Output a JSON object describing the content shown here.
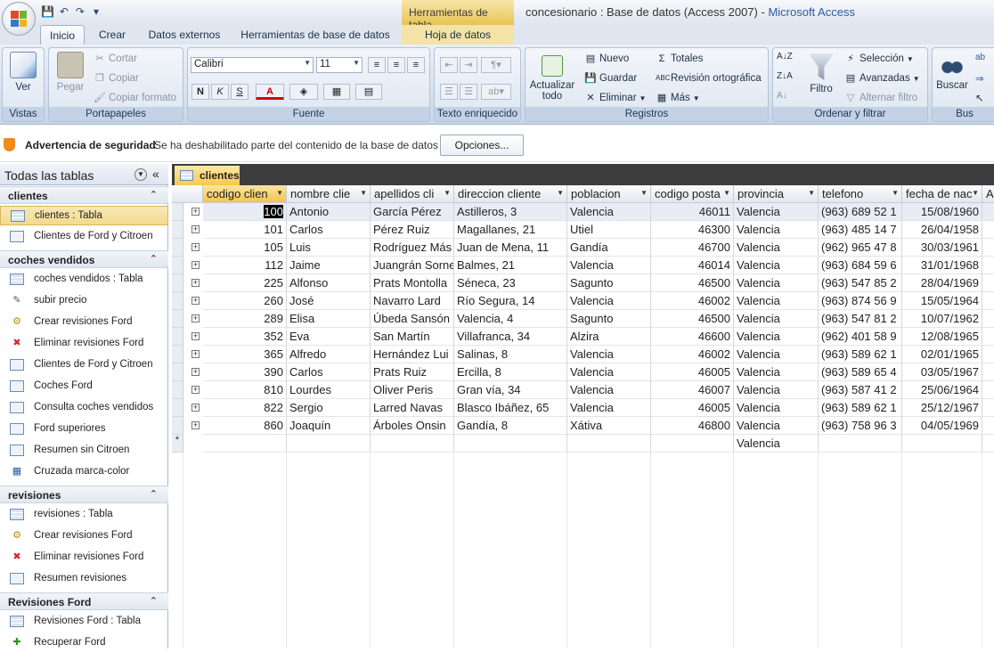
{
  "quick_access": {
    "save": "💾",
    "undo": "↶",
    "redo": "↷",
    "customize": "▾"
  },
  "title": {
    "contextual_tab": "Herramientas de tabla",
    "window_title": "concesionario : Base de datos (Access 2007) -",
    "app_name": "Microsoft Access"
  },
  "tabs": [
    "Inicio",
    "Crear",
    "Datos externos",
    "Herramientas de base de datos",
    "Hoja de datos"
  ],
  "ribbon": {
    "vistas": {
      "label": "Vistas",
      "ver": "Ver"
    },
    "portapapeles": {
      "label": "Portapapeles",
      "pegar": "Pegar",
      "cortar": "Cortar",
      "copiar": "Copiar",
      "copiar_formato": "Copiar formato"
    },
    "fuente": {
      "label": "Fuente",
      "font_name": "Calibri",
      "font_size": "11",
      "bold": "N",
      "italic": "K",
      "underline": "S",
      "color": "A"
    },
    "texto": {
      "label": "Texto enriquecido"
    },
    "registros": {
      "label": "Registros",
      "actualizar": "Actualizar",
      "todo": "todo",
      "nuevo": "Nuevo",
      "guardar": "Guardar",
      "eliminar": "Eliminar",
      "totales": "Totales",
      "revision": "Revisión ortográfica",
      "mas": "Más"
    },
    "ordenar": {
      "label": "Ordenar y filtrar",
      "filtro": "Filtro",
      "seleccion": "Selección",
      "avanzadas": "Avanzadas",
      "alternar": "Alternar filtro"
    },
    "buscar": {
      "label": "Bus",
      "buscar": "Buscar"
    }
  },
  "security": {
    "title": "Advertencia de seguridad",
    "message": "Se ha deshabilitado parte del contenido de la base de datos",
    "options": "Opciones..."
  },
  "nav": {
    "header": "Todas las tablas",
    "groups": [
      {
        "name": "clientes",
        "items": [
          {
            "label": "clientes : Tabla",
            "icon": "table"
          },
          {
            "label": "Clientes de Ford y Citroen",
            "icon": "query"
          }
        ]
      },
      {
        "name": "coches vendidos",
        "items": [
          {
            "label": "coches vendidos : Tabla",
            "icon": "table"
          },
          {
            "label": "subir precio",
            "icon": "update"
          },
          {
            "label": "Crear revisiones Ford",
            "icon": "make-table"
          },
          {
            "label": "Eliminar revisiones Ford",
            "icon": "delete"
          },
          {
            "label": "Clientes de Ford y Citroen",
            "icon": "query"
          },
          {
            "label": "Coches Ford",
            "icon": "query"
          },
          {
            "label": "Consulta coches vendidos",
            "icon": "query"
          },
          {
            "label": "Ford superiores",
            "icon": "query"
          },
          {
            "label": "Resumen sin Citroen",
            "icon": "query"
          },
          {
            "label": "Cruzada marca-color",
            "icon": "crosstab"
          }
        ]
      },
      {
        "name": "revisiones",
        "items": [
          {
            "label": "revisiones : Tabla",
            "icon": "table"
          },
          {
            "label": "Crear revisiones Ford",
            "icon": "make-table"
          },
          {
            "label": "Eliminar revisiones Ford",
            "icon": "delete"
          },
          {
            "label": "Resumen revisiones",
            "icon": "query"
          }
        ]
      },
      {
        "name": "Revisiones Ford",
        "items": [
          {
            "label": "Revisiones Ford : Tabla",
            "icon": "table"
          },
          {
            "label": "Recuperar Ford",
            "icon": "append"
          }
        ]
      }
    ]
  },
  "doc_tab": "clientes",
  "table": {
    "columns": [
      "codigo clien",
      "nombre clie",
      "apellidos cli",
      "direccion cliente",
      "poblacion",
      "codigo posta",
      "provincia",
      "telefono",
      "fecha de nac",
      "A"
    ],
    "rows": [
      [
        "100",
        "Antonio",
        "García Pérez",
        "Astilleros, 3",
        "Valencia",
        "46011",
        "Valencia",
        "(963) 689 52 1",
        "15/08/1960"
      ],
      [
        "101",
        "Carlos",
        "Pérez Ruiz",
        "Magallanes, 21",
        "Utiel",
        "46300",
        "Valencia",
        "(963) 485 14 7",
        "26/04/1958"
      ],
      [
        "105",
        "Luis",
        "Rodríguez Más",
        "Juan de Mena, 11",
        "Gandía",
        "46700",
        "Valencia",
        "(962) 965 47 8",
        "30/03/1961"
      ],
      [
        "112",
        "Jaime",
        "Juangrán Sorne",
        "Balmes, 21",
        "Valencia",
        "46014",
        "Valencia",
        "(963) 684 59 6",
        "31/01/1968"
      ],
      [
        "225",
        "Alfonso",
        "Prats Montolla",
        "Séneca, 23",
        "Sagunto",
        "46500",
        "Valencia",
        "(963) 547 85 2",
        "28/04/1969"
      ],
      [
        "260",
        "José",
        "Navarro Lard",
        "Río Segura, 14",
        "Valencia",
        "46002",
        "Valencia",
        "(963) 874 56 9",
        "15/05/1964"
      ],
      [
        "289",
        "Elisa",
        "Úbeda Sansón",
        "Valencia, 4",
        "Sagunto",
        "46500",
        "Valencia",
        "(963) 547 81 2",
        "10/07/1962"
      ],
      [
        "352",
        "Eva",
        "San Martín",
        "Villafranca, 34",
        "Alzira",
        "46600",
        "Valencia",
        "(962) 401 58 9",
        "12/08/1965"
      ],
      [
        "365",
        "Alfredo",
        "Hernández Lui",
        "Salinas, 8",
        "Valencia",
        "46002",
        "Valencia",
        "(963) 589 62 1",
        "02/01/1965"
      ],
      [
        "390",
        "Carlos",
        "Prats Ruiz",
        "Ercilla, 8",
        "Valencia",
        "46005",
        "Valencia",
        "(963) 589 65 4",
        "03/05/1967"
      ],
      [
        "810",
        "Lourdes",
        "Oliver Peris",
        "Gran vía, 34",
        "Valencia",
        "46007",
        "Valencia",
        "(963) 587 41 2",
        "25/06/1964"
      ],
      [
        "822",
        "Sergio",
        "Larred Navas",
        "Blasco Ibáñez, 65",
        "Valencia",
        "46005",
        "Valencia",
        "(963) 589 62 1",
        "25/12/1967"
      ],
      [
        "860",
        "Joaquín",
        "Árboles Onsin",
        "Gandía, 8",
        "Xátiva",
        "46800",
        "Valencia",
        "(963) 758 96 3",
        "04/05/1969"
      ]
    ],
    "new_row": {
      "marker": "*",
      "provincia_default": "Valencia"
    },
    "expand_glyph": "+"
  }
}
